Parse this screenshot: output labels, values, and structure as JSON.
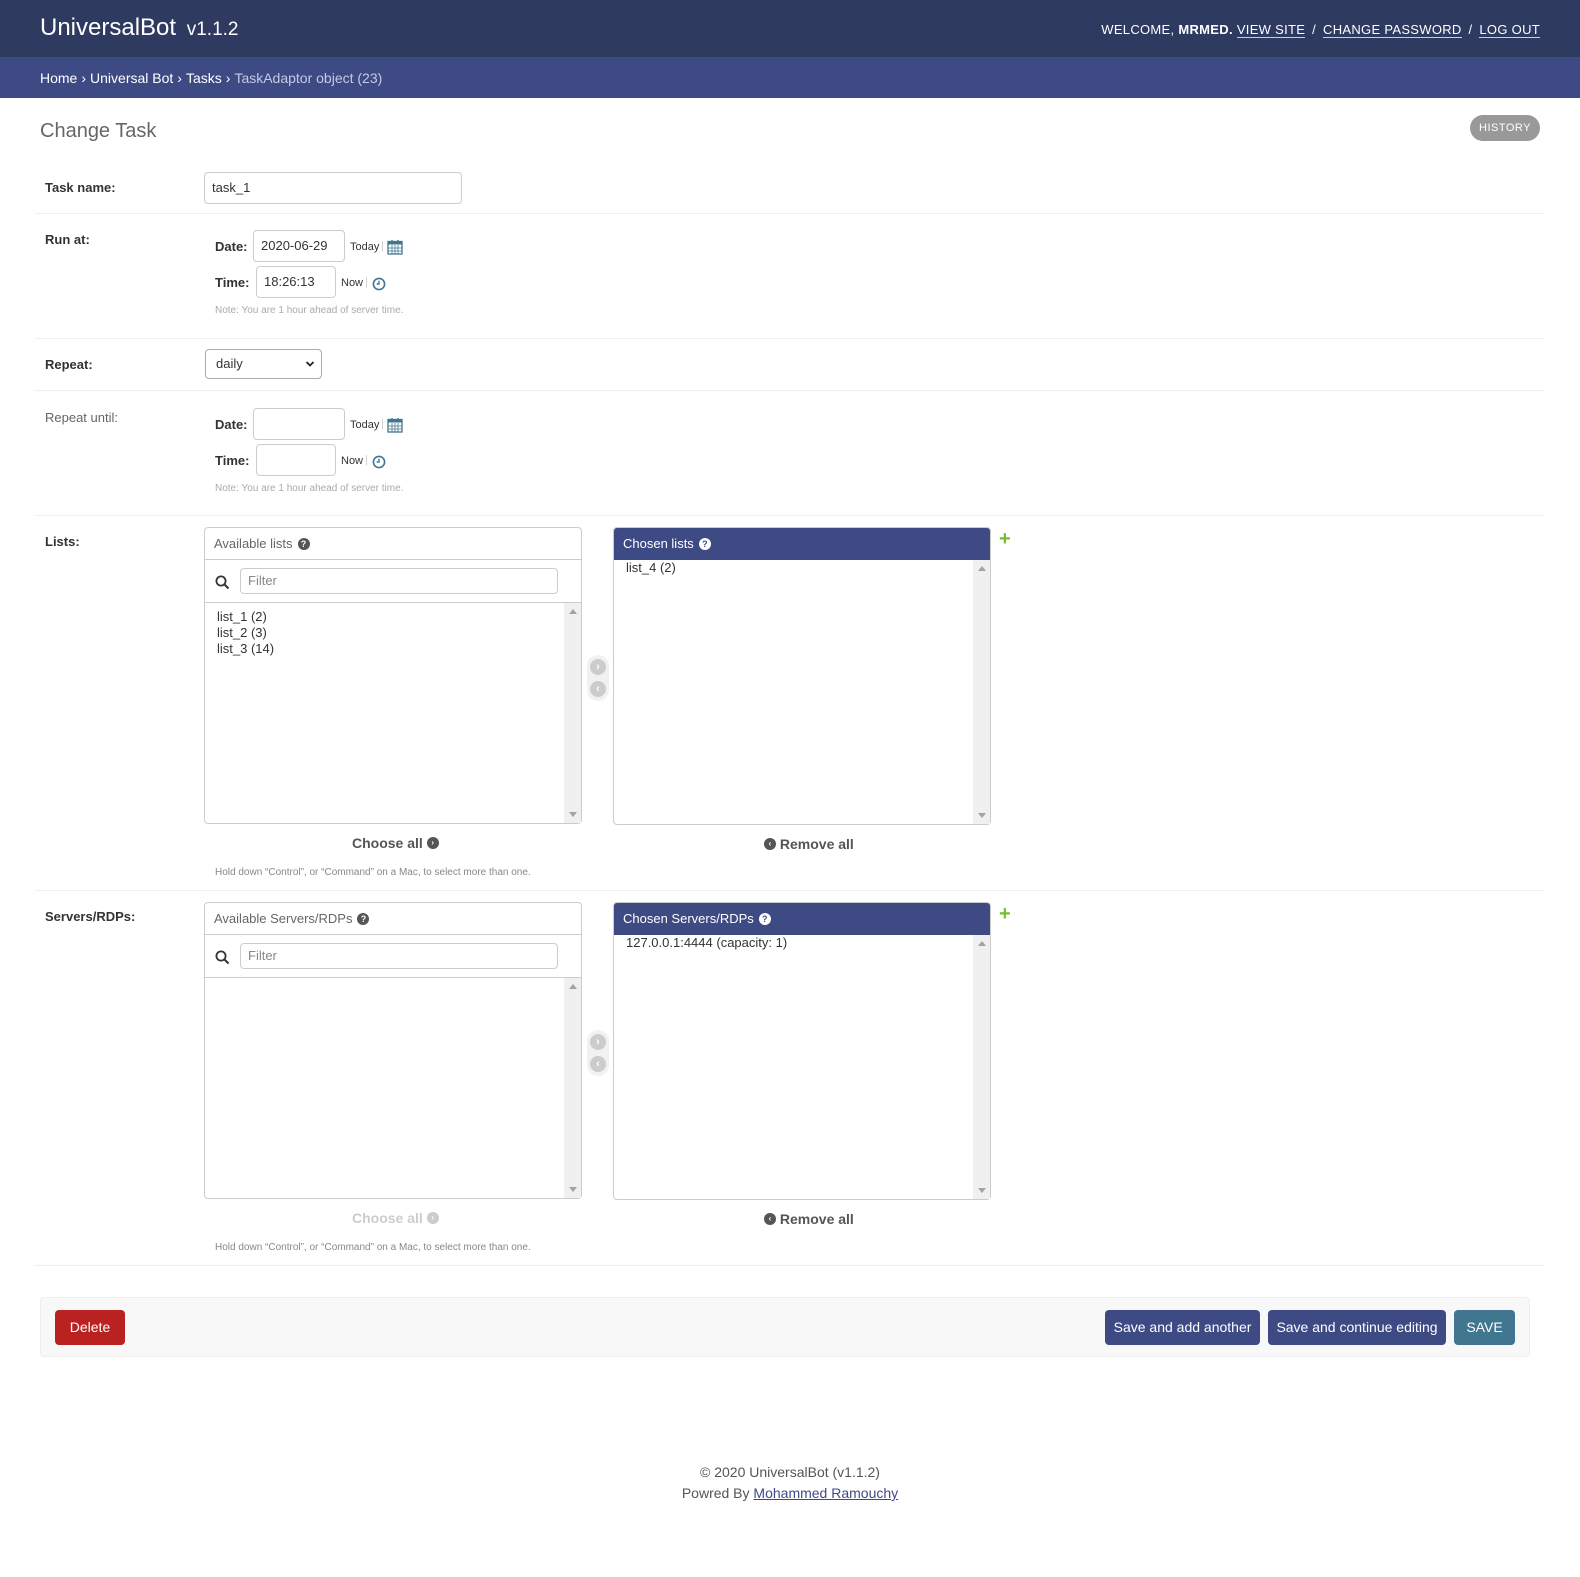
{
  "header": {
    "brand": "UniversalBot",
    "version": "v1.1.2",
    "welcome": "WELCOME,",
    "username": "MRMED.",
    "view_site": "VIEW SITE",
    "change_password": "CHANGE PASSWORD",
    "log_out": "LOG OUT",
    "sep": "/"
  },
  "breadcrumbs": {
    "items": [
      "Home",
      "Universal Bot",
      "Tasks"
    ],
    "current": "TaskAdaptor object (23)",
    "arrow": "›"
  },
  "page": {
    "title": "Change Task",
    "history": "HISTORY"
  },
  "form": {
    "task_name": {
      "label": "Task name:",
      "value": "task_1"
    },
    "run_at": {
      "label": "Run at:",
      "date_label": "Date:",
      "date_value": "2020-06-29",
      "today": "Today",
      "time_label": "Time:",
      "time_value": "18:26:13",
      "now": "Now",
      "pipe": "|",
      "note": "Note: You are 1 hour ahead of server time."
    },
    "repeat": {
      "label": "Repeat:",
      "value": "daily"
    },
    "repeat_until": {
      "label": "Repeat until:",
      "date_label": "Date:",
      "date_value": "",
      "today": "Today",
      "time_label": "Time:",
      "time_value": "",
      "now": "Now",
      "pipe": "|",
      "note": "Note: You are 1 hour ahead of server time."
    },
    "lists": {
      "label": "Lists:",
      "available_title": "Available lists",
      "filter_placeholder": "Filter",
      "available": [
        "list_1 (2)",
        "list_2 (3)",
        "list_3 (14)"
      ],
      "chosen_title": "Chosen lists",
      "chosen": [
        "list_4 (2)"
      ],
      "choose_all": "Choose all",
      "remove_all": "Remove all",
      "help": "Hold down “Control”, or “Command” on a Mac, to select more than one."
    },
    "servers": {
      "label": "Servers/RDPs:",
      "available_title": "Available Servers/RDPs",
      "filter_placeholder": "Filter",
      "available": [],
      "chosen_title": "Chosen Servers/RDPs",
      "chosen": [
        "127.0.0.1:4444 (capacity: 1)"
      ],
      "choose_all": "Choose all",
      "remove_all": "Remove all",
      "help": "Hold down “Control”, or “Command” on a Mac, to select more than one."
    }
  },
  "actions": {
    "delete": "Delete",
    "save_add": "Save and add another",
    "save_continue": "Save and continue editing",
    "save": "SAVE"
  },
  "footer": {
    "copyright": "© 2020 UniversalBot (v1.1.2)",
    "powered_by": "Powred By",
    "author": "Mohammed Ramouchy"
  },
  "icons": {
    "calendar": "calendar-icon",
    "clock": "clock-icon",
    "search": "search-icon",
    "help": "help-icon",
    "add": "add-icon",
    "arrow_right": "arrow-right-icon",
    "arrow_left": "arrow-left-icon"
  },
  "colors": {
    "header": "#2f3a61",
    "breadcrumbs": "#3e4a84",
    "primary_button": "#3e4a84",
    "save_button": "#417690",
    "delete_button": "#ba2121",
    "add_green": "#70bf2b"
  }
}
